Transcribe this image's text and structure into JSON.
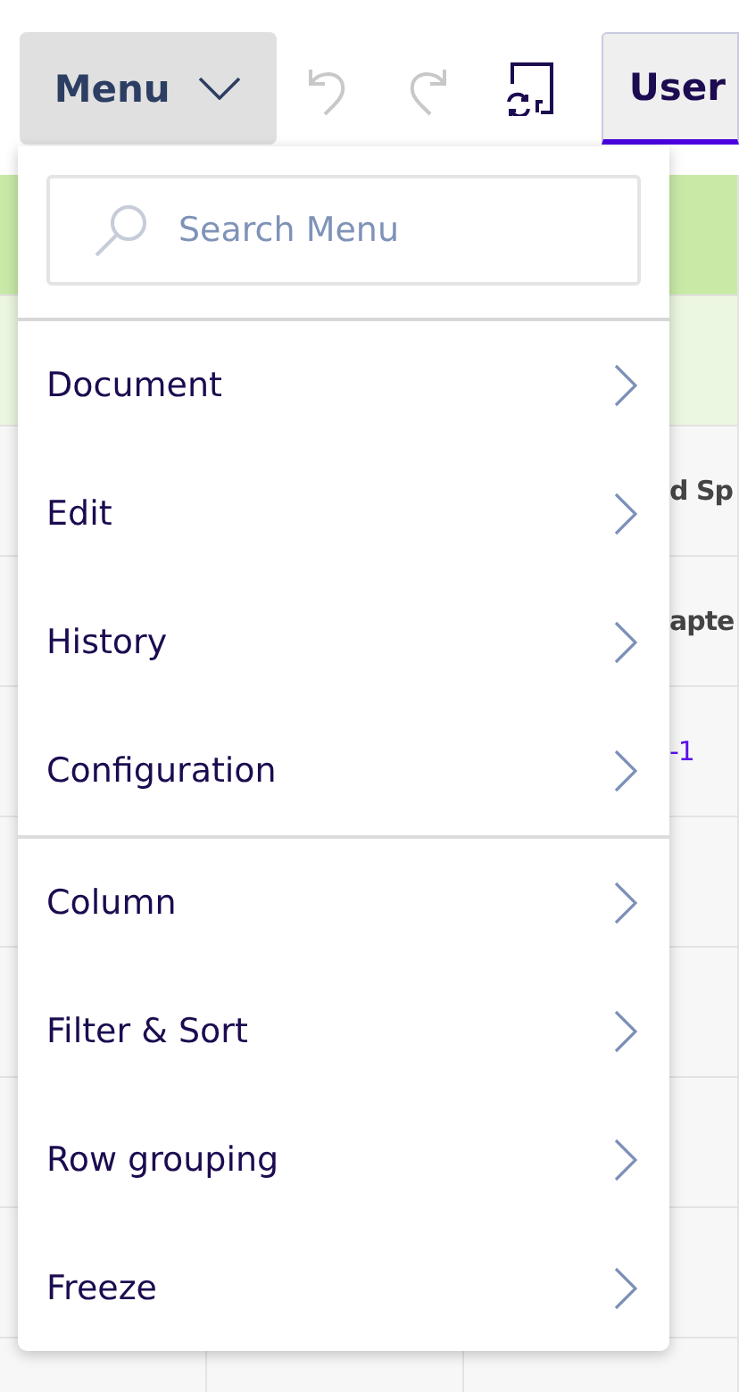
{
  "toolbar": {
    "menu_button": {
      "label": "Menu",
      "expanded": true
    },
    "tab": {
      "label": "User",
      "selected": true
    }
  },
  "grid": {
    "rows": [
      {
        "kind": "header",
        "text": ""
      },
      {
        "kind": "subheader",
        "text": ""
      },
      {
        "kind": "bold",
        "text": "d Sp"
      },
      {
        "kind": "bold",
        "text": "apte"
      },
      {
        "kind": "link",
        "text": "-1"
      },
      {
        "kind": "plain",
        "text": ""
      },
      {
        "kind": "plain",
        "text": ""
      },
      {
        "kind": "plain",
        "text": ""
      },
      {
        "kind": "plain",
        "text": ""
      },
      {
        "kind": "plain",
        "text": ""
      }
    ]
  },
  "menu": {
    "search": {
      "placeholder": "Search Menu"
    },
    "groups": [
      [
        {
          "label": "Document"
        },
        {
          "label": "Edit"
        },
        {
          "label": "History"
        },
        {
          "label": "Configuration"
        }
      ],
      [
        {
          "label": "Column"
        },
        {
          "label": "Filter & Sort"
        },
        {
          "label": "Row grouping"
        },
        {
          "label": "Freeze"
        }
      ]
    ]
  }
}
